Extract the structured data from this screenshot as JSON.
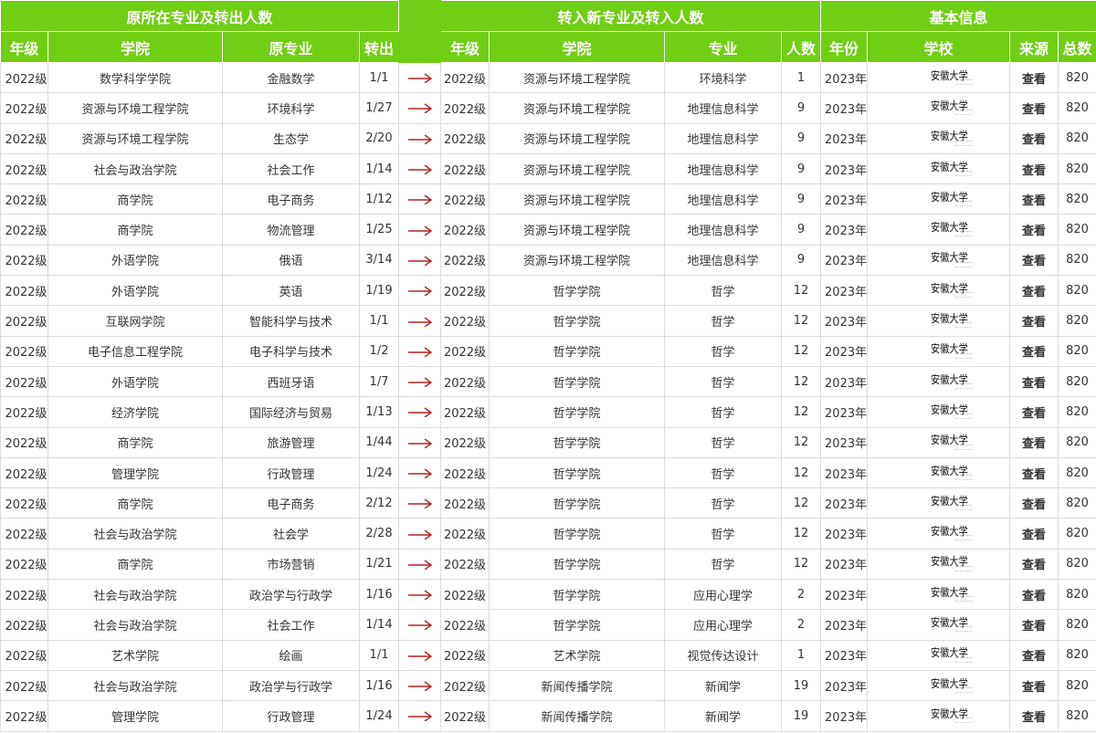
{
  "header": {
    "groups": {
      "original": "原所在专业及转出人数",
      "transfer_in": "转入新专业及转入人数",
      "basic_info": "基本信息"
    },
    "columns": {
      "grade": "年级",
      "college": "学院",
      "orig_major": "原专业",
      "out_count": "转出",
      "new_grade": "年级",
      "new_college": "学院",
      "new_major": "专业",
      "in_count": "人数",
      "year": "年份",
      "school": "学校",
      "source": "来源",
      "total": "总数"
    }
  },
  "colors": {
    "header_green": "#6fcf14",
    "arrow_red": "#b22222"
  },
  "icons": {
    "arrow": "right-arrow-icon"
  },
  "rows": [
    [
      "2022级",
      "数学科学学院",
      "金融数学",
      "1/1",
      "2022级",
      "资源与环境工程学院",
      "环境科学",
      "1",
      "2023年",
      "安徽大学",
      "查看",
      "820"
    ],
    [
      "2022级",
      "资源与环境工程学院",
      "环境科学",
      "1/27",
      "2022级",
      "资源与环境工程学院",
      "地理信息科学",
      "9",
      "2023年",
      "安徽大学",
      "查看",
      "820"
    ],
    [
      "2022级",
      "资源与环境工程学院",
      "生态学",
      "2/20",
      "2022级",
      "资源与环境工程学院",
      "地理信息科学",
      "9",
      "2023年",
      "安徽大学",
      "查看",
      "820"
    ],
    [
      "2022级",
      "社会与政治学院",
      "社会工作",
      "1/14",
      "2022级",
      "资源与环境工程学院",
      "地理信息科学",
      "9",
      "2023年",
      "安徽大学",
      "查看",
      "820"
    ],
    [
      "2022级",
      "商学院",
      "电子商务",
      "1/12",
      "2022级",
      "资源与环境工程学院",
      "地理信息科学",
      "9",
      "2023年",
      "安徽大学",
      "查看",
      "820"
    ],
    [
      "2022级",
      "商学院",
      "物流管理",
      "1/25",
      "2022级",
      "资源与环境工程学院",
      "地理信息科学",
      "9",
      "2023年",
      "安徽大学",
      "查看",
      "820"
    ],
    [
      "2022级",
      "外语学院",
      "俄语",
      "3/14",
      "2022级",
      "资源与环境工程学院",
      "地理信息科学",
      "9",
      "2023年",
      "安徽大学",
      "查看",
      "820"
    ],
    [
      "2022级",
      "外语学院",
      "英语",
      "1/19",
      "2022级",
      "哲学学院",
      "哲学",
      "12",
      "2023年",
      "安徽大学",
      "查看",
      "820"
    ],
    [
      "2022级",
      "互联网学院",
      "智能科学与技术",
      "1/1",
      "2022级",
      "哲学学院",
      "哲学",
      "12",
      "2023年",
      "安徽大学",
      "查看",
      "820"
    ],
    [
      "2022级",
      "电子信息工程学院",
      "电子科学与技术",
      "1/2",
      "2022级",
      "哲学学院",
      "哲学",
      "12",
      "2023年",
      "安徽大学",
      "查看",
      "820"
    ],
    [
      "2022级",
      "外语学院",
      "西班牙语",
      "1/7",
      "2022级",
      "哲学学院",
      "哲学",
      "12",
      "2023年",
      "安徽大学",
      "查看",
      "820"
    ],
    [
      "2022级",
      "经济学院",
      "国际经济与贸易",
      "1/13",
      "2022级",
      "哲学学院",
      "哲学",
      "12",
      "2023年",
      "安徽大学",
      "查看",
      "820"
    ],
    [
      "2022级",
      "商学院",
      "旅游管理",
      "1/44",
      "2022级",
      "哲学学院",
      "哲学",
      "12",
      "2023年",
      "安徽大学",
      "查看",
      "820"
    ],
    [
      "2022级",
      "管理学院",
      "行政管理",
      "1/24",
      "2022级",
      "哲学学院",
      "哲学",
      "12",
      "2023年",
      "安徽大学",
      "查看",
      "820"
    ],
    [
      "2022级",
      "商学院",
      "电子商务",
      "2/12",
      "2022级",
      "哲学学院",
      "哲学",
      "12",
      "2023年",
      "安徽大学",
      "查看",
      "820"
    ],
    [
      "2022级",
      "社会与政治学院",
      "社会学",
      "2/28",
      "2022级",
      "哲学学院",
      "哲学",
      "12",
      "2023年",
      "安徽大学",
      "查看",
      "820"
    ],
    [
      "2022级",
      "商学院",
      "市场营销",
      "1/21",
      "2022级",
      "哲学学院",
      "哲学",
      "12",
      "2023年",
      "安徽大学",
      "查看",
      "820"
    ],
    [
      "2022级",
      "社会与政治学院",
      "政治学与行政学",
      "1/16",
      "2022级",
      "哲学学院",
      "应用心理学",
      "2",
      "2023年",
      "安徽大学",
      "查看",
      "820"
    ],
    [
      "2022级",
      "社会与政治学院",
      "社会工作",
      "1/14",
      "2022级",
      "哲学学院",
      "应用心理学",
      "2",
      "2023年",
      "安徽大学",
      "查看",
      "820"
    ],
    [
      "2022级",
      "艺术学院",
      "绘画",
      "1/1",
      "2022级",
      "艺术学院",
      "视觉传达设计",
      "1",
      "2023年",
      "安徽大学",
      "查看",
      "820"
    ],
    [
      "2022级",
      "社会与政治学院",
      "政治学与行政学",
      "1/16",
      "2022级",
      "新闻传播学院",
      "新闻学",
      "19",
      "2023年",
      "安徽大学",
      "查看",
      "820"
    ],
    [
      "2022级",
      "管理学院",
      "行政管理",
      "1/24",
      "2022级",
      "新闻传播学院",
      "新闻学",
      "19",
      "2023年",
      "安徽大学",
      "查看",
      "820"
    ]
  ]
}
